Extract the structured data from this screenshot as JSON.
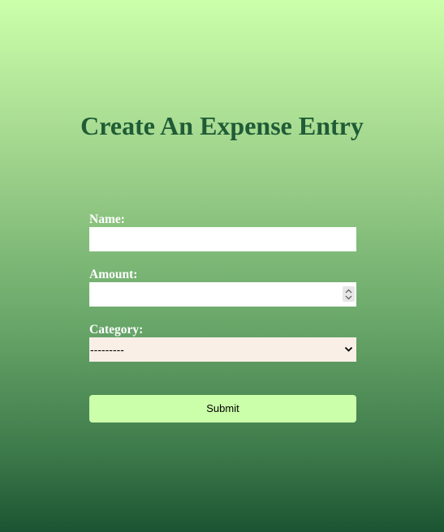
{
  "page": {
    "title": "Create An Expense Entry"
  },
  "form": {
    "name": {
      "label": "Name:",
      "value": ""
    },
    "amount": {
      "label": "Amount:",
      "value": ""
    },
    "category": {
      "label": "Category:",
      "selected": "---------"
    },
    "submit_label": "Submit"
  },
  "colors": {
    "title": "#1f5c36",
    "submit_bg": "#ccffaa",
    "select_bg": "#f9efe6"
  }
}
